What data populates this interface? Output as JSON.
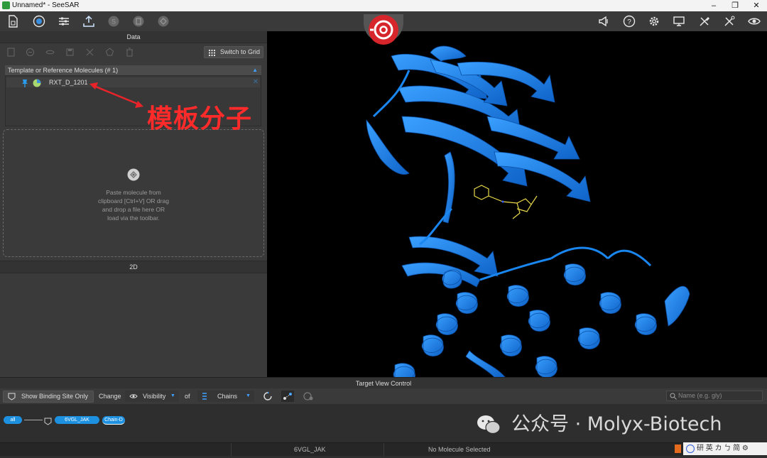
{
  "window": {
    "title": "Unnamed* - SeeSAR",
    "controls": [
      "–",
      "❐",
      "✕"
    ]
  },
  "toolbar": {
    "left_icons": [
      "new-file-icon",
      "analyzer-mode-icon",
      "protein-editor-icon",
      "upload-icon",
      "s-mode-icon",
      "inspirator-icon",
      "docking-icon"
    ],
    "right_icons": [
      "announcement-icon",
      "help-icon",
      "settings-icon",
      "screen-icon",
      "tools-icon",
      "tools-alt-icon",
      "eye-icon"
    ]
  },
  "data_panel": {
    "header": "Data",
    "switch_button": "Switch to Grid",
    "template_header": "Template or Reference Molecules (# 1)",
    "molecule_name": "RXT_D_1201",
    "drop_text_lines": [
      "Paste molecule from",
      "clipboard [Ctrl+V] OR drag",
      "and drop a file here OR",
      "load via the toolbar."
    ],
    "section_2d": "2D"
  },
  "annotation": {
    "text": "模板分子",
    "color": "#ff2a2a"
  },
  "target_view": {
    "header": "Target View Control",
    "show_binding_site": "Show Binding Site Only",
    "change_label": "Change",
    "visibility_label": "Visibility",
    "of_label": "of",
    "chains_label": "Chains",
    "name_placeholder": "Name (e.g. gly)",
    "pills": {
      "all": "all",
      "protein": "6VGL_JAK",
      "chain": "Chain-D"
    }
  },
  "statusbar": {
    "protein": "6VGL_JAK",
    "molecule_status": "No Molecule Selected"
  },
  "watermark": {
    "text": "公众号 · Molyx-Biotech"
  },
  "corner": {
    "text": "研 英 カ ㄅ 简 ⚙"
  },
  "colors": {
    "protein": "#1a86f0",
    "accent_red": "#d7262b",
    "pill_blue": "#1e90e0"
  }
}
